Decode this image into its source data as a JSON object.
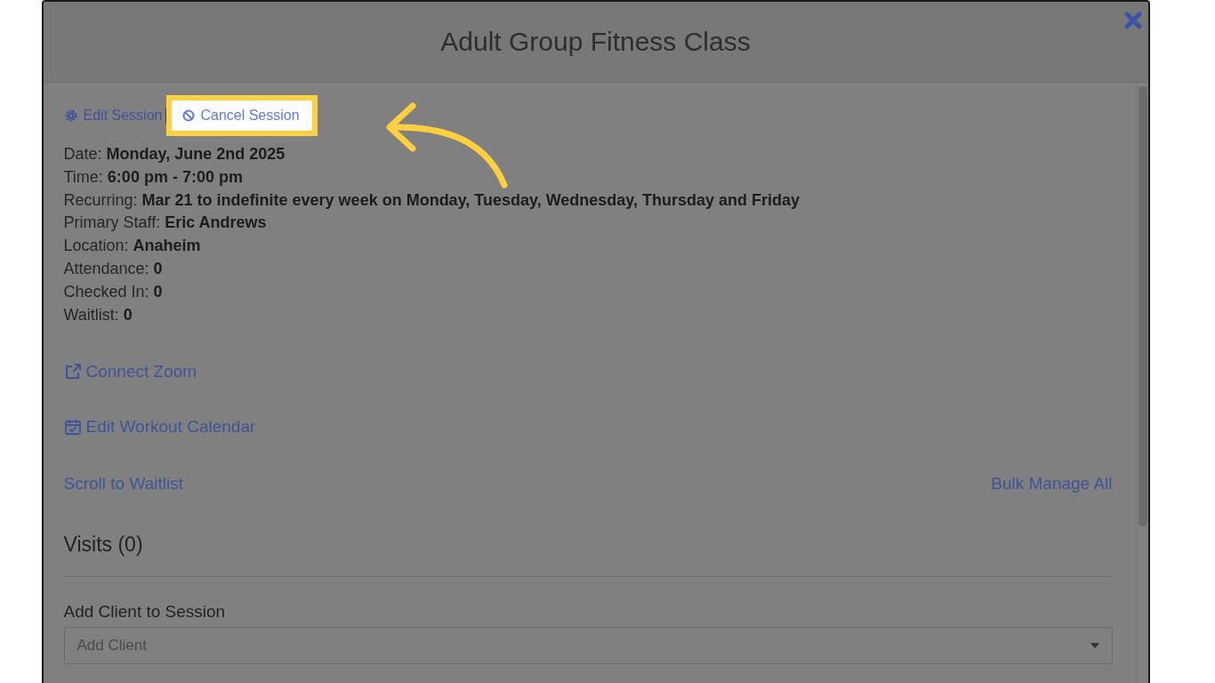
{
  "modal": {
    "title": "Adult Group Fitness Class"
  },
  "session_actions": [
    {
      "kind": "settings",
      "label": "Edit Session",
      "highlighted": false
    },
    {
      "kind": "cancel",
      "label": "Cancel Session",
      "highlighted": true
    }
  ],
  "details": [
    {
      "label": "Date:",
      "value": "Monday, June 2nd 2025"
    },
    {
      "label": "Time:",
      "value": "6:00 pm - 7:00 pm"
    },
    {
      "label": "Recurring:",
      "value": "Mar 21 to indefinite every week on Monday, Tuesday, Wednesday, Thursday and Friday"
    },
    {
      "label": "Primary Staff:",
      "value": "Eric Andrews"
    },
    {
      "label": "Location:",
      "value": "Anaheim"
    },
    {
      "label": "Attendance:",
      "value": "0"
    },
    {
      "label": "Checked In:",
      "value": "0"
    },
    {
      "label": "Waitlist:",
      "value": "0"
    }
  ],
  "links": [
    {
      "kind": "external",
      "label": "Connect Zoom"
    },
    {
      "kind": "calendar",
      "label": "Edit Workout Calendar"
    }
  ],
  "scroll_link": "Scroll to Waitlist",
  "bulk_link": "Bulk Manage All",
  "visits_heading": "Visits (0)",
  "add_client": {
    "label": "Add Client to Session",
    "placeholder": "Add Client"
  }
}
